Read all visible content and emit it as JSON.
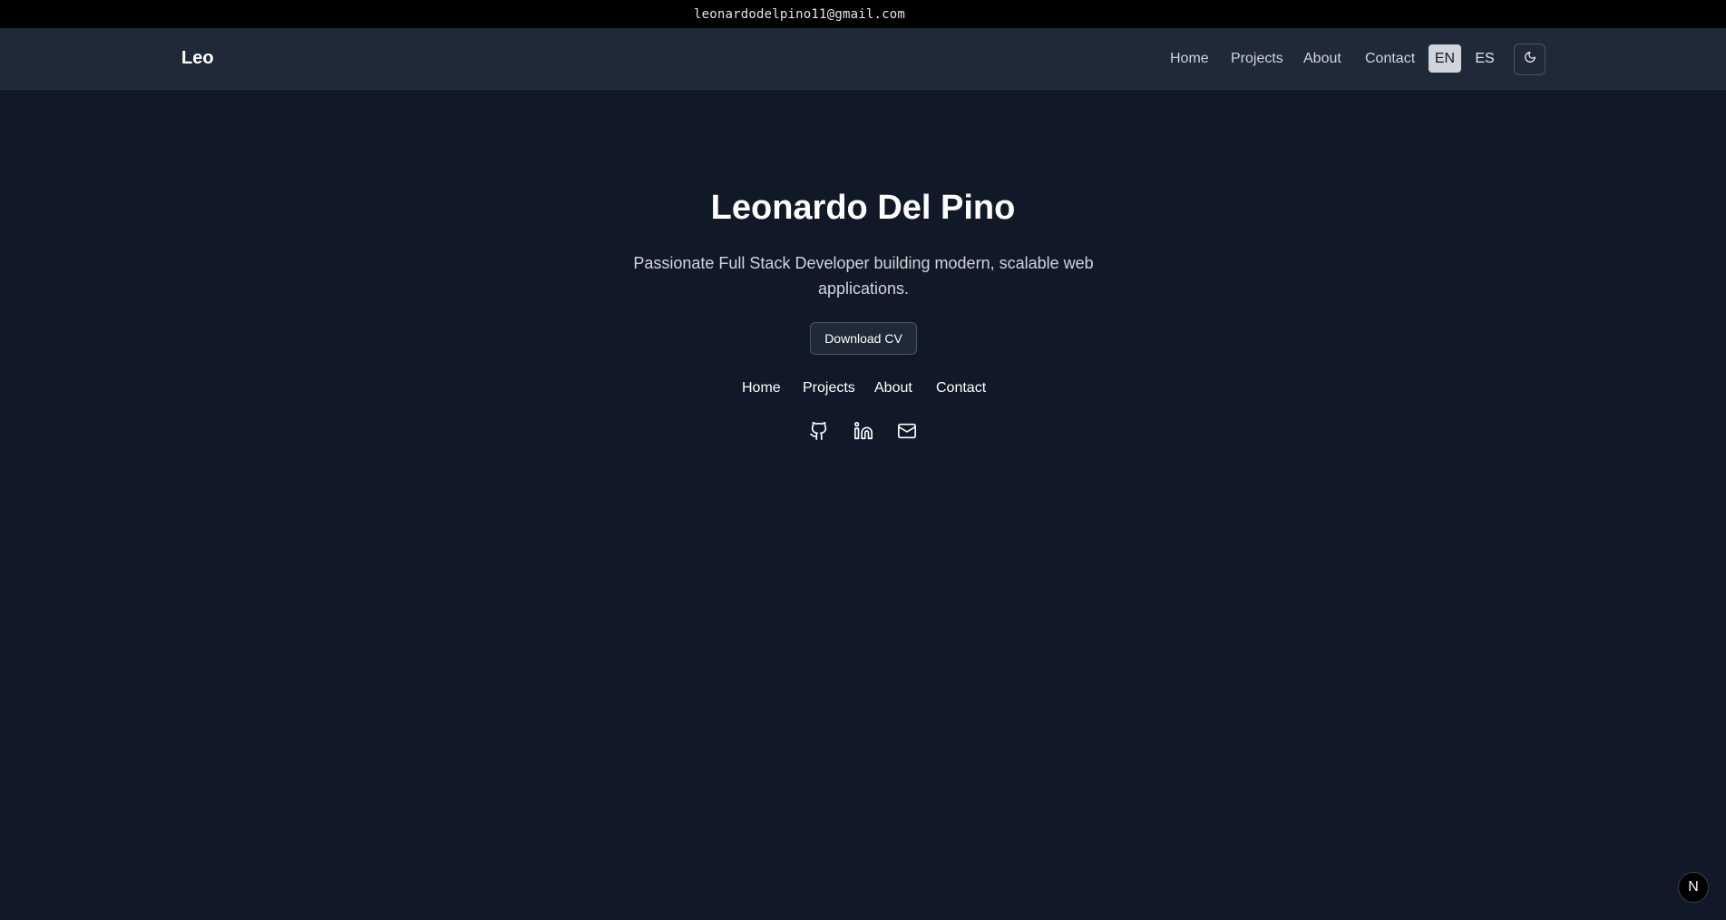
{
  "topbar": {
    "email": "leonardodelpino11@gmail.com"
  },
  "navbar": {
    "brand": "Leo",
    "links": [
      "Home",
      "Projects",
      "About",
      "Contact"
    ],
    "languages": [
      "EN",
      "ES"
    ],
    "active_language": "EN",
    "theme_icon": "moon-icon"
  },
  "hero": {
    "title": "Leonardo Del Pino",
    "subtitle": "Passionate Full Stack Developer building modern, scalable web applications.",
    "cv_button": "Download CV",
    "links": [
      "Home",
      "Projects",
      "About",
      "Contact"
    ],
    "social_icons": [
      "github-icon",
      "linkedin-icon",
      "mail-icon"
    ]
  },
  "badge": {
    "label": "N"
  },
  "colors": {
    "background": "#111827",
    "navbar": "#1f2937",
    "topbar": "#000000",
    "active_lang": "#d1d5db"
  }
}
